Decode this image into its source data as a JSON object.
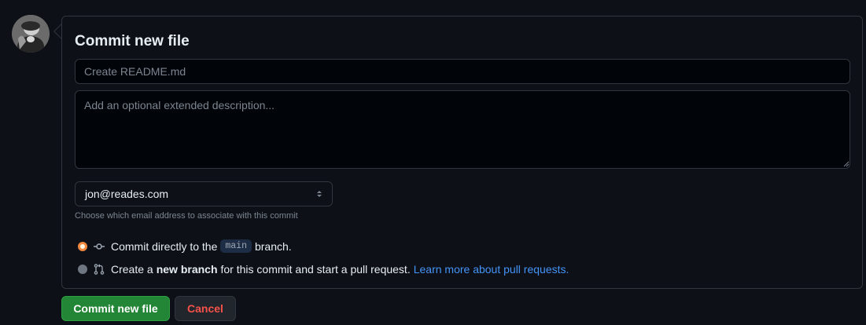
{
  "form": {
    "title": "Commit new file",
    "summary_placeholder": "Create README.md",
    "description_placeholder": "Add an optional extended description...",
    "email": {
      "selected": "jon@reades.com",
      "note": "Choose which email address to associate with this commit"
    },
    "options": {
      "direct": {
        "selected": true,
        "text_before": "Commit directly to the",
        "branch": "main",
        "text_after": "branch."
      },
      "new_branch": {
        "selected": false,
        "text_before": "Create a",
        "strong": "new branch",
        "text_after": "for this commit and start a pull request.",
        "link": "Learn more about pull requests."
      }
    }
  },
  "buttons": {
    "commit": "Commit new file",
    "cancel": "Cancel"
  },
  "icons": {
    "avatar": "user-avatar",
    "commit": "git-commit-icon",
    "pull_request": "git-pull-request-icon",
    "select": "select-arrows-icon"
  },
  "colors": {
    "accent": "#238636",
    "danger": "#f85149",
    "link": "#4493f8",
    "radio_selected": "#f0883e"
  }
}
